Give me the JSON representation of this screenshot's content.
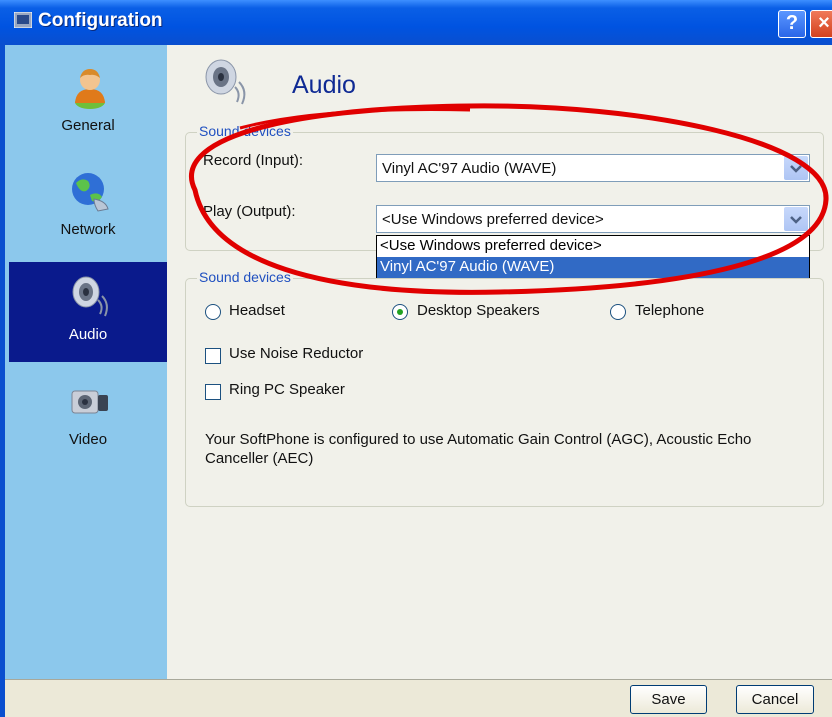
{
  "window": {
    "title": "Configuration",
    "help_icon": "question-icon",
    "close_icon": "close-icon"
  },
  "sidebar": {
    "items": [
      {
        "label": "General",
        "icon": "user-icon"
      },
      {
        "label": "Network",
        "icon": "globe-icon"
      },
      {
        "label": "Audio",
        "icon": "speaker-icon",
        "active": true
      },
      {
        "label": "Video",
        "icon": "camera-icon"
      }
    ]
  },
  "page": {
    "title": "Audio",
    "icon": "speaker-icon"
  },
  "devices_group": {
    "legend": "Sound devices",
    "record_label": "Record (Input):",
    "record_value": "Vinyl AC'97 Audio (WAVE)",
    "play_label": "Play (Output):",
    "play_value": "<Use Windows preferred device>",
    "play_options": [
      "<Use Windows preferred device>",
      "Vinyl AC'97 Audio (WAVE)"
    ],
    "play_highlighted": "Vinyl AC'97 Audio (WAVE)"
  },
  "mode_group": {
    "legend": "Sound devices",
    "radios": [
      {
        "label": "Headset",
        "selected": false
      },
      {
        "label": "Desktop Speakers",
        "selected": true
      },
      {
        "label": "Telephone",
        "selected": false
      }
    ],
    "checkboxes": [
      {
        "label": "Use Noise Reductor",
        "checked": false
      },
      {
        "label": "Ring PC Speaker",
        "checked": false
      }
    ],
    "info": "Your SoftPhone is configured to use Automatic Gain Control (AGC), Acoustic Echo Canceller (AEC)"
  },
  "footer": {
    "save_label": "Save",
    "cancel_label": "Cancel"
  },
  "colors": {
    "title_bar": "#0053e1",
    "sidebar": "#8cc8ec",
    "sidebar_active": "#0a1a8c",
    "highlight": "#316ac5",
    "annotation": "#e00000"
  }
}
